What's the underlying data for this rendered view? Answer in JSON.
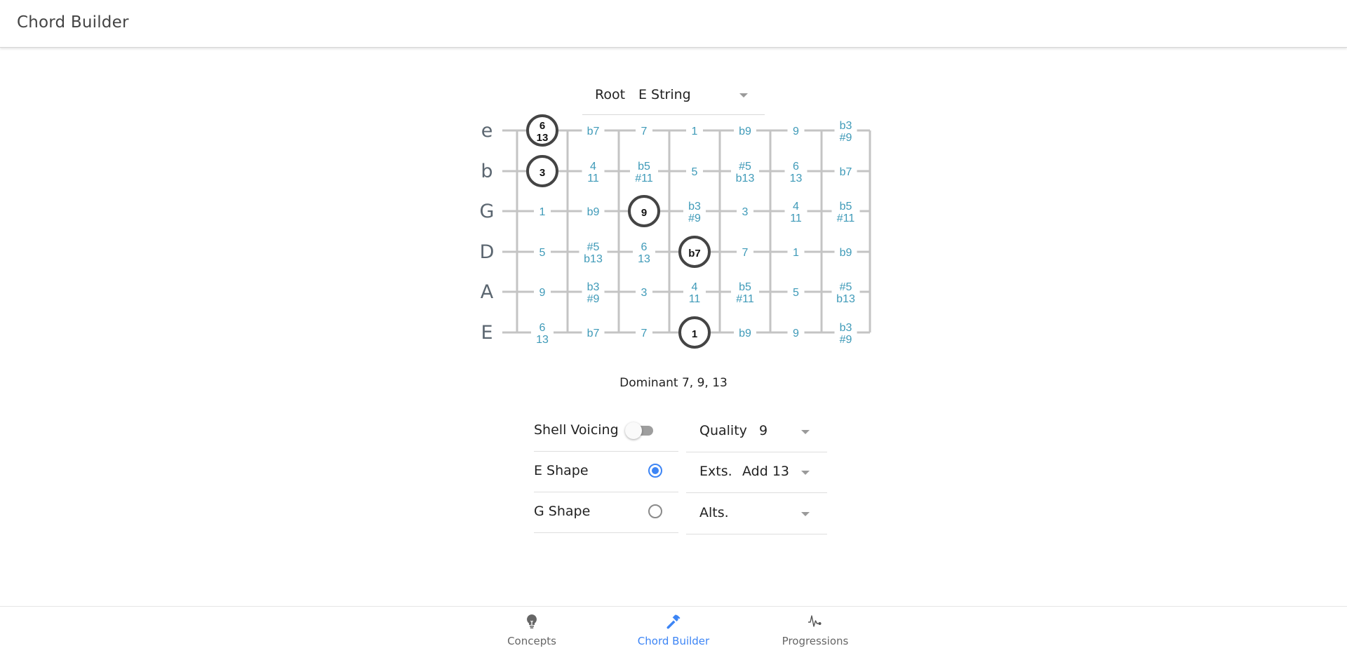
{
  "appbar": {
    "title": "Chord Builder"
  },
  "root_select": {
    "label": "Root",
    "value": "E String"
  },
  "fretboard": {
    "strings": [
      "e",
      "b",
      "G",
      "D",
      "A",
      "E"
    ],
    "frets": 8,
    "cells": [
      [
        [
          "6",
          "13"
        ],
        [
          "b7"
        ],
        [
          "7"
        ],
        [
          "1"
        ],
        [
          "b9"
        ],
        [
          "9"
        ],
        [
          "b3",
          "#9"
        ]
      ],
      [
        [
          "3"
        ],
        [
          "4",
          "11"
        ],
        [
          "b5",
          "#11"
        ],
        [
          "5"
        ],
        [
          "#5",
          "b13"
        ],
        [
          "6",
          "13"
        ],
        [
          "b7"
        ]
      ],
      [
        [
          "1"
        ],
        [
          "b9"
        ],
        [
          "9"
        ],
        [
          "b3",
          "#9"
        ],
        [
          "3"
        ],
        [
          "4",
          "11"
        ],
        [
          "b5",
          "#11"
        ]
      ],
      [
        [
          "5"
        ],
        [
          "#5",
          "b13"
        ],
        [
          "6",
          "13"
        ],
        [
          "b7"
        ],
        [
          "7"
        ],
        [
          "1"
        ],
        [
          "b9"
        ]
      ],
      [
        [
          "9"
        ],
        [
          "b3",
          "#9"
        ],
        [
          "3"
        ],
        [
          "4",
          "11"
        ],
        [
          "b5",
          "#11"
        ],
        [
          "5"
        ],
        [
          "#5",
          "b13"
        ]
      ],
      [
        [
          "6",
          "13"
        ],
        [
          "b7"
        ],
        [
          "7"
        ],
        [
          "1"
        ],
        [
          "b9"
        ],
        [
          "9"
        ],
        [
          "b3",
          "#9"
        ]
      ]
    ],
    "selected": [
      {
        "string": 0,
        "slot": 0
      },
      {
        "string": 1,
        "slot": 0
      },
      {
        "string": 2,
        "slot": 2
      },
      {
        "string": 3,
        "slot": 3
      },
      {
        "string": 5,
        "slot": 3
      }
    ],
    "colors": {
      "interval": "#3f9ab8",
      "selected_text": "#111111",
      "selected_ring": "#444444",
      "line": "#c4c4c4",
      "string_label": "#5b6670"
    }
  },
  "chord_name": "Dominant 7, 9, 13",
  "controls": {
    "shell_voicing": {
      "label": "Shell Voicing",
      "on": false
    },
    "shapes": [
      {
        "label": "E Shape",
        "selected": true
      },
      {
        "label": "G Shape",
        "selected": false
      }
    ],
    "quality": {
      "label": "Quality",
      "value": "9"
    },
    "extensions": {
      "label": "Exts.",
      "value": "Add 13"
    },
    "alterations": {
      "label": "Alts.",
      "value": ""
    }
  },
  "bottom_nav": {
    "accent": "#3d85f5",
    "items": [
      {
        "label": "Concepts",
        "icon": "lightbulb-icon",
        "active": false
      },
      {
        "label": "Chord Builder",
        "icon": "hammer-icon",
        "active": true
      },
      {
        "label": "Progressions",
        "icon": "pulse-icon",
        "active": false
      }
    ]
  }
}
